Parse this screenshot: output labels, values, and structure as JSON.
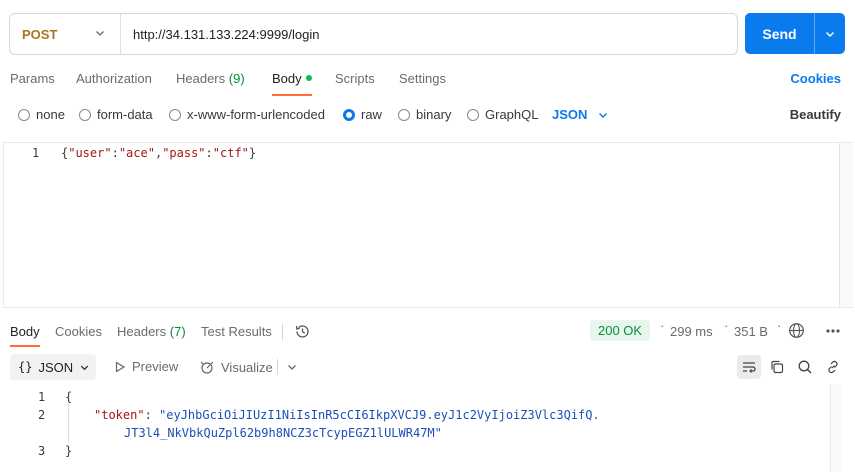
{
  "request": {
    "method": "POST",
    "url": "http://34.131.133.224:9999/login",
    "send_label": "Send"
  },
  "request_tabs": {
    "params": "Params",
    "authorization": "Authorization",
    "headers": "Headers",
    "headers_count": "(9)",
    "body": "Body",
    "scripts": "Scripts",
    "settings": "Settings",
    "cookies": "Cookies",
    "active": "Body"
  },
  "body_types": {
    "none": "none",
    "form_data": "form-data",
    "urlencoded": "x-www-form-urlencoded",
    "raw": "raw",
    "binary": "binary",
    "graphql": "GraphQL",
    "selected": "raw",
    "language": "JSON",
    "beautify": "Beautify"
  },
  "request_body": {
    "line_number": "1",
    "tokens": [
      {
        "t": "{",
        "c": "punc"
      },
      {
        "t": "\"user\"",
        "c": "key"
      },
      {
        "t": ":",
        "c": "punc"
      },
      {
        "t": "\"ace\"",
        "c": "str"
      },
      {
        "t": ",",
        "c": "punc"
      },
      {
        "t": "\"pass\"",
        "c": "key"
      },
      {
        "t": ":",
        "c": "punc"
      },
      {
        "t": "\"ctf\"",
        "c": "str"
      },
      {
        "t": "}",
        "c": "punc"
      }
    ]
  },
  "response_tabs": {
    "body": "Body",
    "cookies": "Cookies",
    "headers": "Headers",
    "headers_count": "(7)",
    "test_results": "Test Results",
    "active": "Body"
  },
  "response_meta": {
    "status": "200 OK",
    "time": "299 ms",
    "size": "351 B",
    "status_color": "#0a8a3a"
  },
  "response_toolbar": {
    "format": "JSON",
    "preview": "Preview",
    "visualize": "Visualize"
  },
  "response_body": {
    "lines": [
      "1",
      "2",
      "3"
    ],
    "open_brace": "{",
    "close_brace": "}",
    "token_key": "\"token\"",
    "colon": ": ",
    "token_part1": "\"eyJhbGciOiJIUzI1NiIsInR5cCI6IkpXVCJ9.eyJ1c2VyIjoiZ3Vlc3QifQ.",
    "token_part2": "JT3l4_NkVbkQuZpl62b9h8NCZ3cTcypEGZ1lULWR47M\""
  },
  "colors": {
    "accent": "#097bed",
    "active_tab_underline": "#ff6c37",
    "method": "#a6771e",
    "body_dot": "#0cbb52"
  },
  "icons": [
    "chevron-down-icon",
    "history-icon",
    "globe-icon",
    "more-icon",
    "preview-play-icon",
    "visualize-icon",
    "wrap-lines-icon",
    "copy-icon",
    "search-icon",
    "link-icon",
    "braces-icon"
  ]
}
